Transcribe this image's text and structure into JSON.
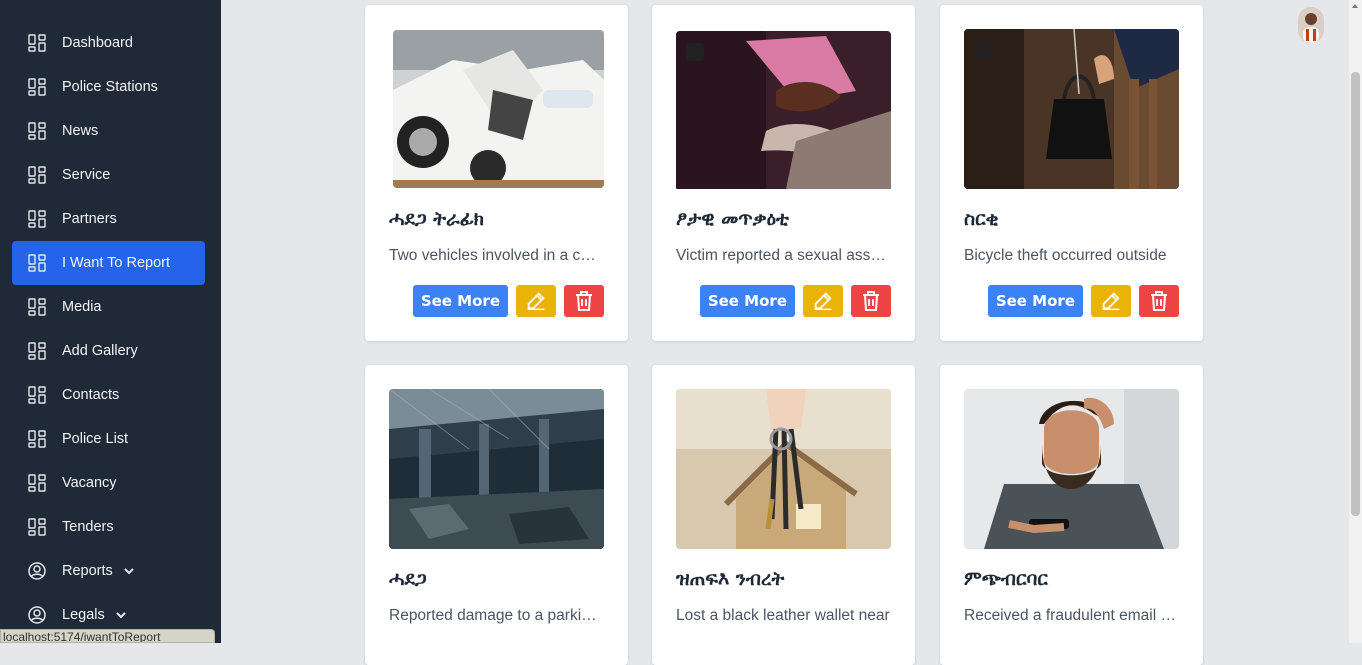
{
  "sidebar": {
    "items": [
      {
        "label": "Dashboard",
        "icon": "grid-icon"
      },
      {
        "label": "Police Stations",
        "icon": "grid-icon"
      },
      {
        "label": "News",
        "icon": "grid-icon"
      },
      {
        "label": "Service",
        "icon": "grid-icon"
      },
      {
        "label": "Partners",
        "icon": "grid-icon"
      },
      {
        "label": "I Want To Report",
        "icon": "grid-icon",
        "active": true
      },
      {
        "label": "Media",
        "icon": "grid-icon"
      },
      {
        "label": "Add Gallery",
        "icon": "grid-icon"
      },
      {
        "label": "Contacts",
        "icon": "grid-icon"
      },
      {
        "label": "Police List",
        "icon": "grid-icon"
      },
      {
        "label": "Vacancy",
        "icon": "grid-icon"
      },
      {
        "label": "Tenders",
        "icon": "grid-icon"
      },
      {
        "label": "Reports",
        "icon": "user-circle-icon",
        "dropdown": true
      },
      {
        "label": "Legals",
        "icon": "user-circle-icon",
        "dropdown": true
      }
    ]
  },
  "status_url": "localhost:5174/iwantToReport",
  "cards": [
    {
      "title": "ሓደጋ ትራፊክ",
      "desc": "Two vehicles involved in a collision",
      "image": "car-accident-photo",
      "see_more": "See More"
    },
    {
      "title": "ፆታዊ መጥቃዕቲ",
      "desc": "Victim reported a sexual assault",
      "image": "hands-support-photo",
      "see_more": "See More"
    },
    {
      "title": "ስርቂ",
      "desc": "Bicycle theft occurred outside",
      "image": "bag-theft-photo",
      "see_more": "See More"
    },
    {
      "title": "ሓደጋ",
      "desc": "Reported damage to a parking area",
      "image": "ruined-building-photo"
    },
    {
      "title": "ዝጠፍእ ንብረት",
      "desc": "Lost a black leather wallet near",
      "image": "keys-house-photo"
    },
    {
      "title": "ምጭብርባር",
      "desc": "Received a fraudulent email message",
      "image": "stressed-man-phone-photo"
    }
  ],
  "colors": {
    "sidebar_bg": "#1f2937",
    "active_bg": "#2563eb",
    "see_more": "#3b82f6",
    "edit": "#eab308",
    "delete": "#ef4444"
  }
}
